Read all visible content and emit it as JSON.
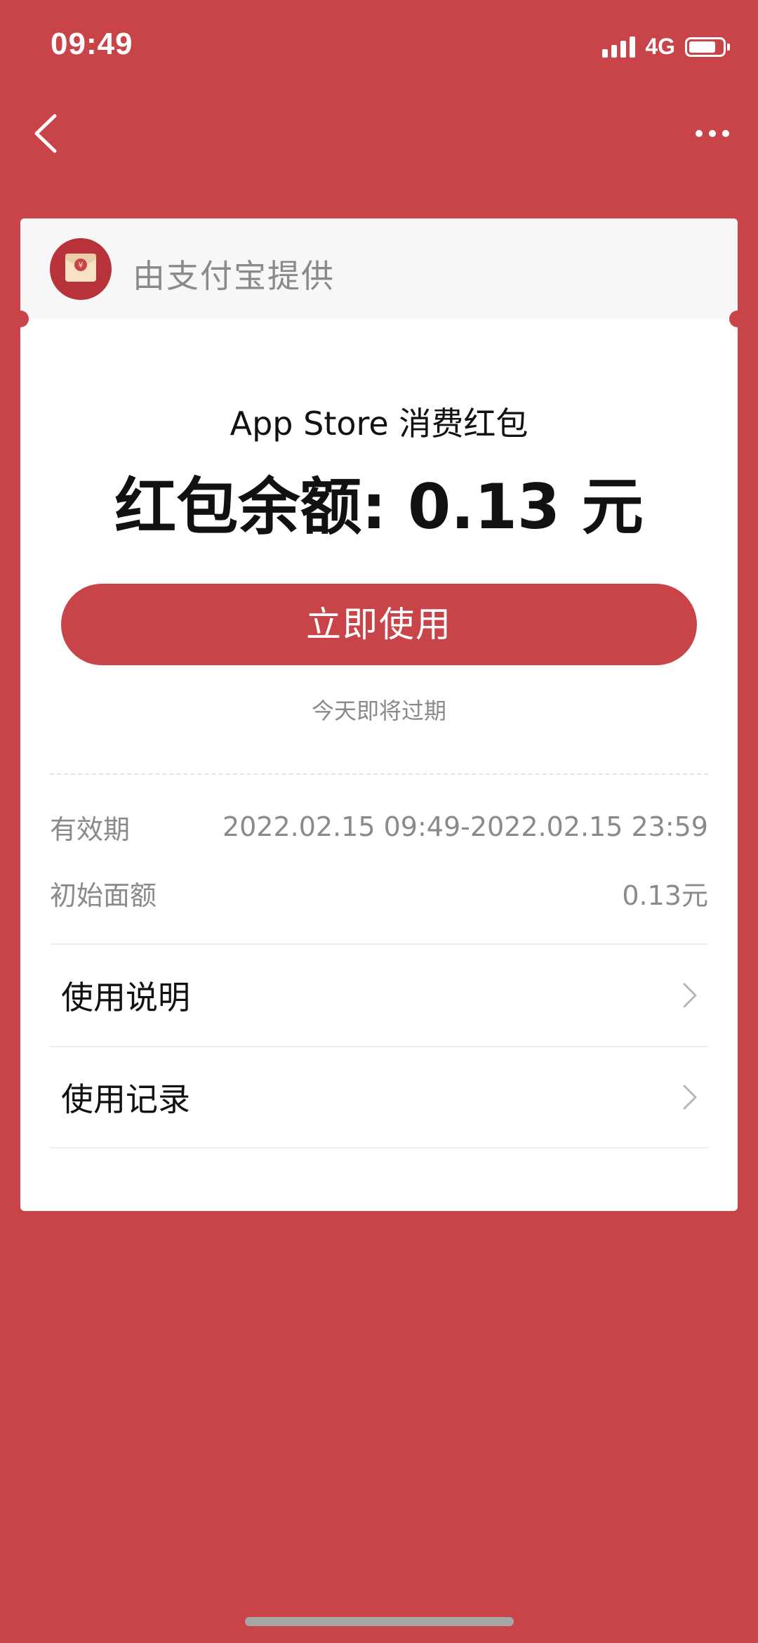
{
  "status_bar": {
    "time": "09:49",
    "network": "4G",
    "battery_level": 0.8,
    "signal_bars": 4
  },
  "nav": {
    "back_icon": "chevron-left-icon",
    "more_icon": "more-dots-icon"
  },
  "header": {
    "provider_text": "由支付宝提供",
    "logo_icon": "red-envelope-icon"
  },
  "coupon": {
    "name": "App Store 消费红包",
    "balance_text": "红包余额: 0.13 元"
  },
  "actions": {
    "use_now": "立即使用"
  },
  "expire_note": "今天即将过期",
  "info": {
    "validity_label": "有效期",
    "validity_value": "2022.02.15 09:49-2022.02.15 23:59",
    "initial_label": "初始面额",
    "initial_value": "0.13元"
  },
  "menu": {
    "instructions": "使用说明",
    "records": "使用记录"
  },
  "colors": {
    "brand_red": "#c94448",
    "text_dark": "#111111",
    "text_gray": "#8a8a8a"
  }
}
